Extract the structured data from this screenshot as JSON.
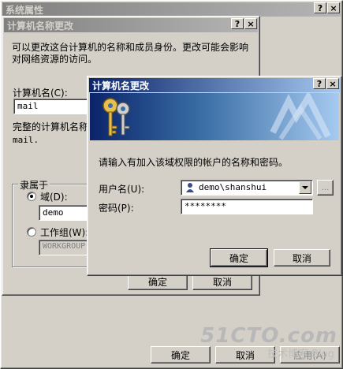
{
  "sysprops": {
    "title": "系统属性",
    "buttons": {
      "ok": "确定",
      "cancel": "取消",
      "apply": "应用(A)"
    }
  },
  "rename_dialog": {
    "title": "计算机名称更改",
    "description": "可以更改这台计算机的名称和成员身份。更改可能会影响对网络资源的访问。",
    "computer_name_label": "计算机名(C):",
    "computer_name_value": "mail",
    "full_name_label": "完整的计算机名称:",
    "full_name_value": "mail.",
    "member_of_label": "隶属于",
    "domain_label": "域(D):",
    "domain_value": "demo",
    "workgroup_label": "工作组(W):",
    "workgroup_value": "WORKGROUP",
    "buttons": {
      "ok": "确定",
      "cancel": "取消"
    }
  },
  "cred_dialog": {
    "title": "计算机名更改",
    "prompt": "请输入有加入该域权限的帐户的名称和密码。",
    "username_label": "用户名(U):",
    "username_value": "demo\\shanshui",
    "browse_label": "...",
    "password_label": "密码(P):",
    "password_value": "********",
    "buttons": {
      "ok": "确定",
      "cancel": "取消"
    }
  },
  "titlebar_buttons": {
    "help": "?",
    "close": "×"
  },
  "watermark": {
    "main": "51CTO.com",
    "sub": "技术博客 Blog"
  }
}
